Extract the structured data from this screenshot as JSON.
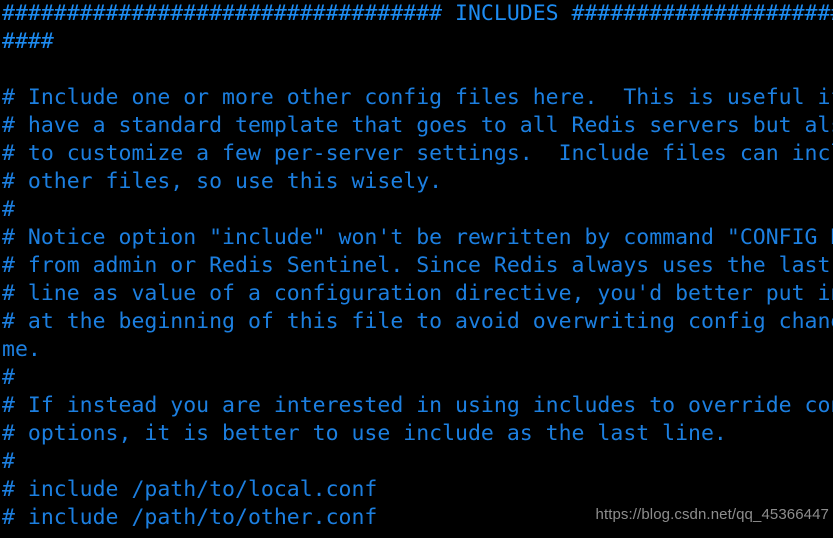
{
  "window": {
    "kind": "terminal-text-view",
    "background_color": "#000000",
    "text_color": "#1c7fe0",
    "rule_color": "#1d8cf2",
    "font": "monospace",
    "columns_visible": 62,
    "rows_visible": 18
  },
  "document": {
    "section_title": "INCLUDES",
    "lines": [
      "################################## INCLUDES ###########################",
      "####",
      "",
      "# Include one or more other config files here.  This is useful if you",
      "# have a standard template that goes to all Redis servers but also need",
      "# to customize a few per-server settings.  Include files can include",
      "# other files, so use this wisely.",
      "#",
      "# Notice option \"include\" won't be rewritten by command \"CONFIG REWRITE\"",
      "# from admin or Redis Sentinel. Since Redis always uses the last proces",
      "# line as value of a configuration directive, you'd better put includes",
      "# at the beginning of this file to avoid overwriting config change at ru",
      "me.",
      "#",
      "# If instead you are interested in using includes to override configurat",
      "# options, it is better to use include as the last line.",
      "#",
      "# include /path/to/local.conf",
      "# include /path/to/other.conf"
    ],
    "line_kinds": [
      "rule",
      "rule",
      "blank",
      "comment",
      "comment",
      "comment",
      "comment",
      "comment",
      "comment",
      "comment",
      "comment",
      "comment",
      "wrap",
      "comment",
      "comment",
      "comment",
      "comment",
      "comment",
      "comment"
    ]
  },
  "watermark": {
    "text": "https://blog.csdn.net/qq_45366447",
    "color": "#9a9a9a"
  }
}
